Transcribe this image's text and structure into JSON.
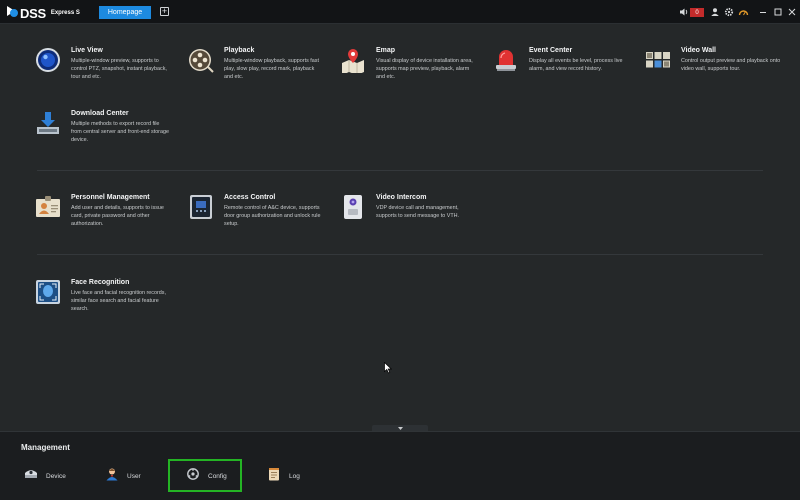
{
  "app": {
    "logo_text": "DSS",
    "logo_sub": "Express S",
    "home_tab": "Homepage",
    "add_tab": "+",
    "alarm_count": "0"
  },
  "modules": [
    {
      "title": "Live View",
      "desc": "Multiple-window preview, supports to control PTZ, snapshot, instant playback, tour and etc.",
      "icon": "live-view-icon"
    },
    {
      "title": "Playback",
      "desc": "Multiple-window playback, supports fast play, slow play, record mark, playback and etc.",
      "icon": "playback-icon"
    },
    {
      "title": "Emap",
      "desc": "Visual display of device installation area, supports map preview, playback, alarm and etc.",
      "icon": "emap-icon"
    },
    {
      "title": "Event Center",
      "desc": "Display all events be level, process live alarm, and view record history.",
      "icon": "event-center-icon"
    },
    {
      "title": "Video Wall",
      "desc": "Control output preview and playback onto video wall, supports tour.",
      "icon": "video-wall-icon"
    },
    {
      "title": "Download Center",
      "desc": "Multiple methods to export record file from central server and front-end storage device.",
      "icon": "download-center-icon"
    },
    {
      "title": "Personnel Management",
      "desc": "Add user and details, supports to issue card, private password and other authorization.",
      "icon": "personnel-icon"
    },
    {
      "title": "Access Control",
      "desc": "Remote control of A&C device, supports door group authorization and unlock rule setup.",
      "icon": "access-control-icon"
    },
    {
      "title": "Video Intercom",
      "desc": "VDP device call and management, supports to send message to VTH.",
      "icon": "video-intercom-icon"
    },
    {
      "title": "Face Recognition",
      "desc": "Live face and facial recognition records, similar face search and facial feature search.",
      "icon": "face-recognition-icon"
    }
  ],
  "management": {
    "title": "Management",
    "items": [
      {
        "label": "Device",
        "icon": "device-icon"
      },
      {
        "label": "User",
        "icon": "user-icon"
      },
      {
        "label": "Config",
        "icon": "config-icon"
      },
      {
        "label": "Log",
        "icon": "log-icon"
      }
    ]
  },
  "colors": {
    "accent": "#1d8ae0",
    "highlight": "#24b424",
    "alarm": "#c32b2b"
  }
}
